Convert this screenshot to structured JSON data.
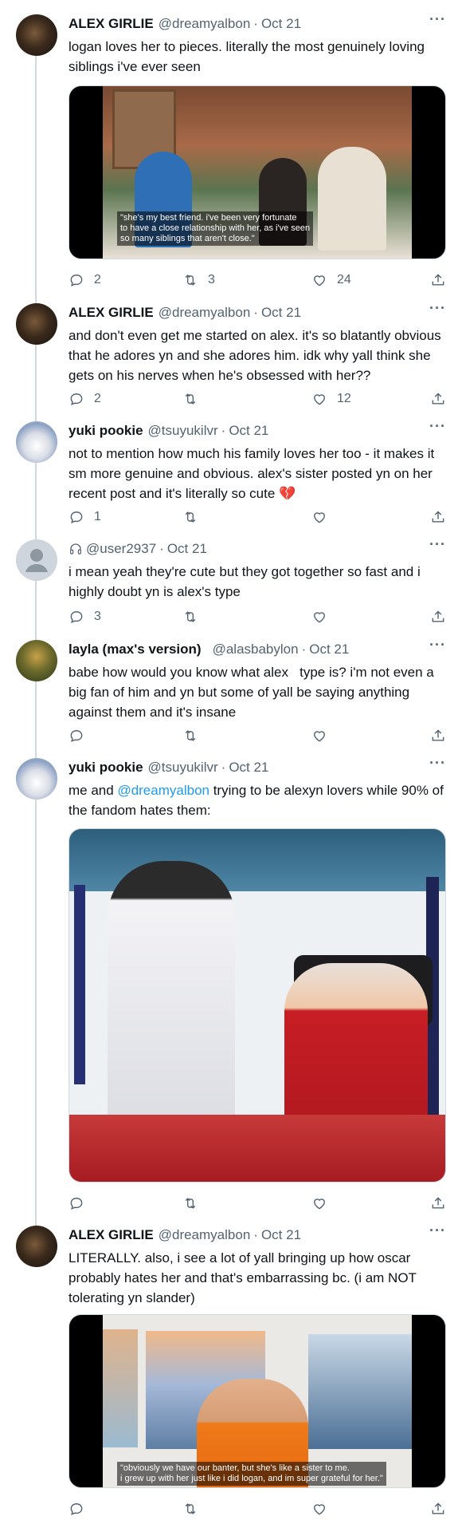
{
  "tweets": [
    {
      "name": "ALEX GIRLIE",
      "handle": "@dreamyalbon",
      "date": "Oct 21",
      "text": "logan loves her to pieces. literally the most genuinely loving siblings i've ever seen",
      "media_caption": [
        "\"she's my best friend. i've been very fortunate",
        "to have a close relationship with her, as i've seen",
        "so many siblings that aren't close.\""
      ],
      "replies": "2",
      "retweets": "3",
      "likes": "24"
    },
    {
      "name": "ALEX GIRLIE",
      "handle": "@dreamyalbon",
      "date": "Oct 21",
      "text": "and don't even get me started on alex. it's so blatantly obvious that he adores yn and she adores him. idk why yall think she gets on his nerves when he's obsessed with her??",
      "replies": "2",
      "retweets": "",
      "likes": "12"
    },
    {
      "name": "yuki pookie",
      "handle": "@tsuyukilvr",
      "date": "Oct 21",
      "text": "not to mention how much his family loves her too - it makes it sm more genuine and obvious. alex's sister posted yn on her recent post and it's literally so cute 💔",
      "replies": "1",
      "retweets": "",
      "likes": ""
    },
    {
      "name": "",
      "handle": "@user2937",
      "date": "Oct 21",
      "text": "i mean yeah they're cute but they got together so fast and i highly doubt yn is alex's type",
      "replies": "3",
      "retweets": "",
      "likes": ""
    },
    {
      "name": "layla (max's version)",
      "handle": "@alasbabylon",
      "date": "Oct 21",
      "text": "babe how would you know what alex   type is? i'm not even a big fan of him and yn but some of yall be saying anything against them and it's insane",
      "replies": "",
      "retweets": "",
      "likes": ""
    },
    {
      "name": "yuki pookie",
      "handle": "@tsuyukilvr",
      "date": "Oct 21",
      "text_before": "me and ",
      "mention": "@dreamyalbon",
      "text_after": " trying to be alexyn lovers while 90% of the fandom hates them:",
      "replies": "",
      "retweets": "",
      "likes": ""
    },
    {
      "name": "ALEX GIRLIE",
      "handle": "@dreamyalbon",
      "date": "Oct 21",
      "text": "LITERALLY. also, i see a lot of yall bringing up how oscar probably hates her and that's embarrassing bc. (i am NOT tolerating yn slander)",
      "media_caption": [
        "\"obviously we have our banter, but she's like a sister to me.",
        "i grew up with her just like i did logan, and im super grateful for her.\""
      ],
      "replies": "",
      "retweets": "",
      "likes": ""
    }
  ],
  "colors": {
    "text": "#0f1419",
    "muted": "#536471",
    "link": "#1d9bf0",
    "line": "#cfd9de"
  },
  "icons": {
    "reply": "reply-icon",
    "retweet": "retweet-icon",
    "like": "heart-icon",
    "share": "share-icon",
    "more": "more-icon"
  }
}
